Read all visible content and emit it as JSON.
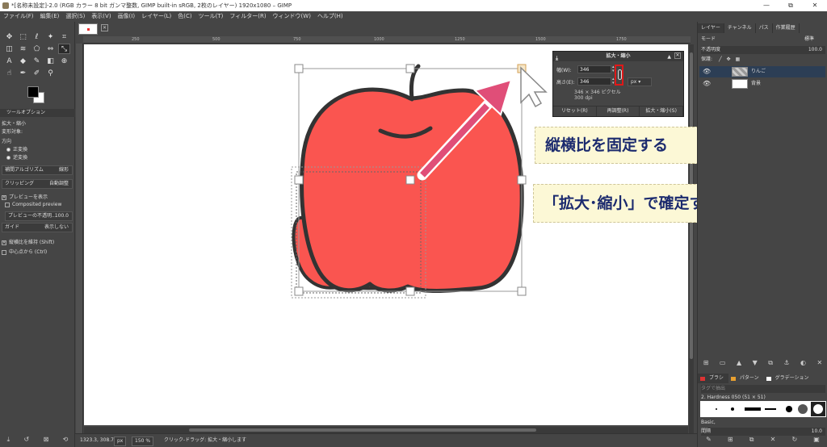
{
  "window": {
    "title": "*[名称未設定]-2.0 (RGB カラー 8 bit ガンマ整数, GIMP built-in sRGB, 2枚のレイヤー) 1920x1080 – GIMP",
    "controls": [
      "—",
      "⧉",
      "✕"
    ]
  },
  "menu": [
    "ファイル(F)",
    "編集(E)",
    "選択(S)",
    "表示(V)",
    "画像(I)",
    "レイヤー(L)",
    "色(C)",
    "ツール(T)",
    "フィルター(R)",
    "ウィンドウ(W)",
    "ヘルプ(H)"
  ],
  "ruler_ticks": [
    "250",
    "500",
    "750",
    "1000",
    "1250",
    "1500",
    "1750"
  ],
  "tool_options": {
    "tab_label": "ツールオプション",
    "tool_name": "拡大・縮小",
    "transform_label": "変形対象:",
    "direction_label": "方向",
    "direction_normal": "正変換",
    "direction_reverse": "逆変換",
    "interp_label": "補間アルゴリズム",
    "interp_value": "線形",
    "clipping_label": "クリッピング",
    "clipping_value": "自動調整",
    "show_preview": "プレビューを表示",
    "composited_preview": "Composited preview",
    "preview_opacity_label": "プレビューの不透明...",
    "preview_opacity_value": "100.0",
    "guide_label": "ガイド",
    "guide_value": "表示しない",
    "keep_aspect": "縦横比を維持 (Shift)",
    "from_center": "中心点から (Ctrl)"
  },
  "scale_dialog": {
    "title": "拡大・縮小",
    "width_label": "幅(W):",
    "width_value": "346",
    "height_label": "高さ(E):",
    "height_value": "346",
    "unit": "px",
    "pixel_info": "346 × 346 ピクセル",
    "resolution": "300 dpi",
    "btn_reset": "リセット(R)",
    "btn_readjust": "再調整(R)",
    "btn_scale": "拡大・縮小(S)"
  },
  "callouts": {
    "aspect": "縦横比を固定する",
    "confirm": "「拡大･縮小」で確定する"
  },
  "status": {
    "coords": "1323.3, 308.7",
    "unit": "px",
    "zoom": "150 %",
    "message": "クリック-ドラッグ: 拡大・縮小します"
  },
  "right_panel": {
    "tabs": [
      "レイヤー",
      "チャンネル",
      "パス",
      "作業履歴"
    ],
    "mode_label": "モード",
    "mode_value": "標準",
    "opacity_label": "不透明度",
    "opacity_value": "100.0",
    "lock_label": "保護:",
    "layers": [
      {
        "name": "りんご"
      },
      {
        "name": "背景"
      }
    ],
    "brush_tabs": [
      "ブラシ",
      "パターン",
      "グラデーション"
    ],
    "brush_filter_placeholder": "タグで抽出",
    "brush_name": "2. Hardness 050 (51 × 51)",
    "brush_tag": "Basic,",
    "spacing_label": "間隔",
    "spacing_value": "10.0"
  },
  "colors": {
    "apple_red": "#fa5550",
    "arrow_pink": "#e04e78",
    "callout_text": "#1b2a6e",
    "highlight": "#e01818"
  }
}
